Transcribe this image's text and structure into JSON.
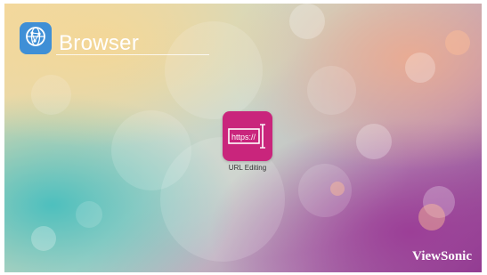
{
  "app": {
    "title": "Browser",
    "logo_icon": "globe-network-icon",
    "accent": "#3f8fd6"
  },
  "tiles": [
    {
      "icon_text": "https://",
      "label": "URL Editing",
      "icon": "url-editing-icon",
      "color": "#c9257c"
    }
  ],
  "brand": "ViewSonic"
}
